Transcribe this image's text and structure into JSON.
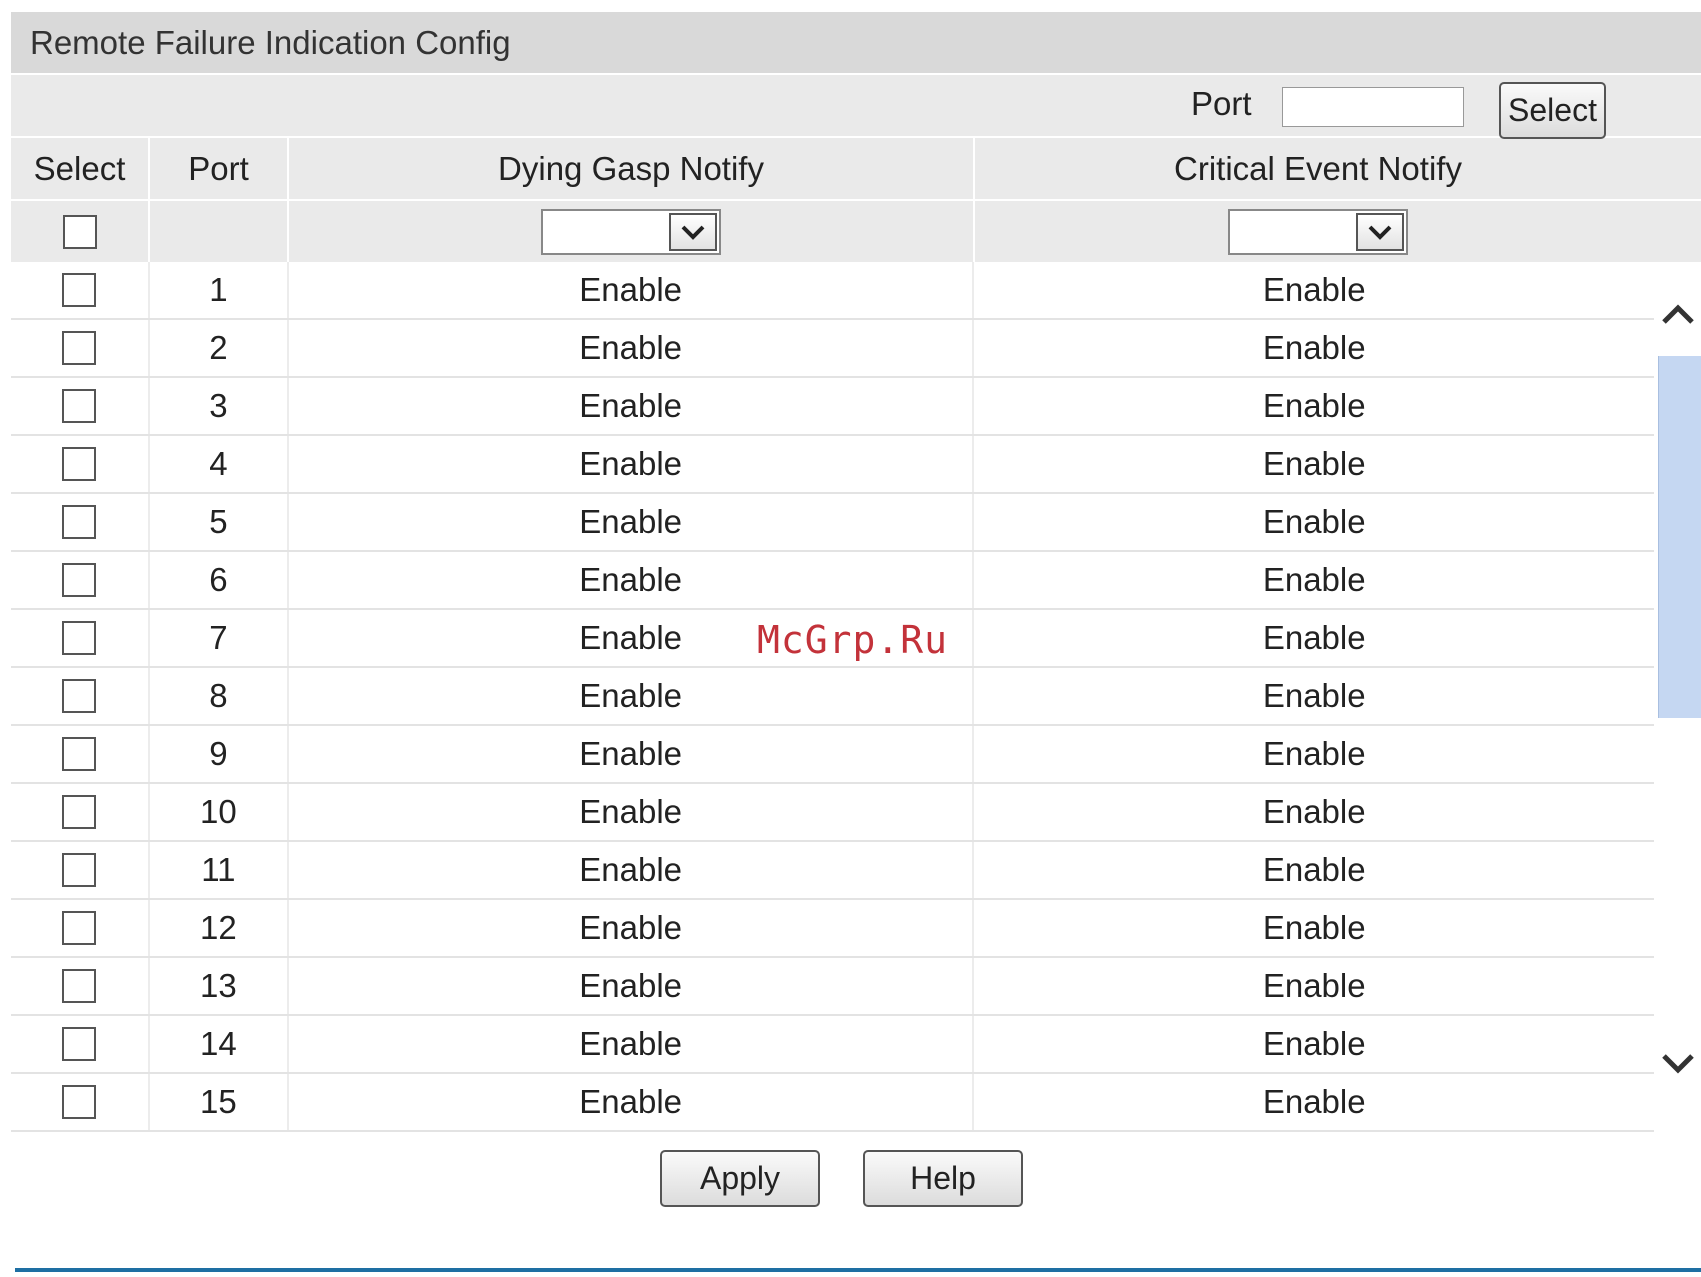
{
  "panel": {
    "title": "Remote Failure Indication Config"
  },
  "port_filter": {
    "label": "Port",
    "value": "",
    "button_label": "Select"
  },
  "table": {
    "headers": {
      "select": "Select",
      "port": "Port",
      "dying": "Dying Gasp Notify",
      "critical": "Critical Event Notify"
    },
    "bulk": {
      "dying_value": "",
      "critical_value": ""
    },
    "rows": [
      {
        "port": "1",
        "dying": "Enable",
        "critical": "Enable"
      },
      {
        "port": "2",
        "dying": "Enable",
        "critical": "Enable"
      },
      {
        "port": "3",
        "dying": "Enable",
        "critical": "Enable"
      },
      {
        "port": "4",
        "dying": "Enable",
        "critical": "Enable"
      },
      {
        "port": "5",
        "dying": "Enable",
        "critical": "Enable"
      },
      {
        "port": "6",
        "dying": "Enable",
        "critical": "Enable"
      },
      {
        "port": "7",
        "dying": "Enable",
        "critical": "Enable"
      },
      {
        "port": "8",
        "dying": "Enable",
        "critical": "Enable"
      },
      {
        "port": "9",
        "dying": "Enable",
        "critical": "Enable"
      },
      {
        "port": "10",
        "dying": "Enable",
        "critical": "Enable"
      },
      {
        "port": "11",
        "dying": "Enable",
        "critical": "Enable"
      },
      {
        "port": "12",
        "dying": "Enable",
        "critical": "Enable"
      },
      {
        "port": "13",
        "dying": "Enable",
        "critical": "Enable"
      },
      {
        "port": "14",
        "dying": "Enable",
        "critical": "Enable"
      },
      {
        "port": "15",
        "dying": "Enable",
        "critical": "Enable"
      }
    ]
  },
  "actions": {
    "apply_label": "Apply",
    "help_label": "Help"
  },
  "watermark": "McGrp.Ru",
  "icons": {
    "dropdown": "chevron-down-icon",
    "scroll_up": "chevron-up-icon",
    "scroll_down": "chevron-down-icon"
  },
  "colors": {
    "header_bg": "#d9d9d9",
    "subheader_bg": "#eaeaea",
    "scroll_thumb": "#c5d7f2",
    "divider": "#1e6fa3",
    "watermark": "#c3323a"
  }
}
